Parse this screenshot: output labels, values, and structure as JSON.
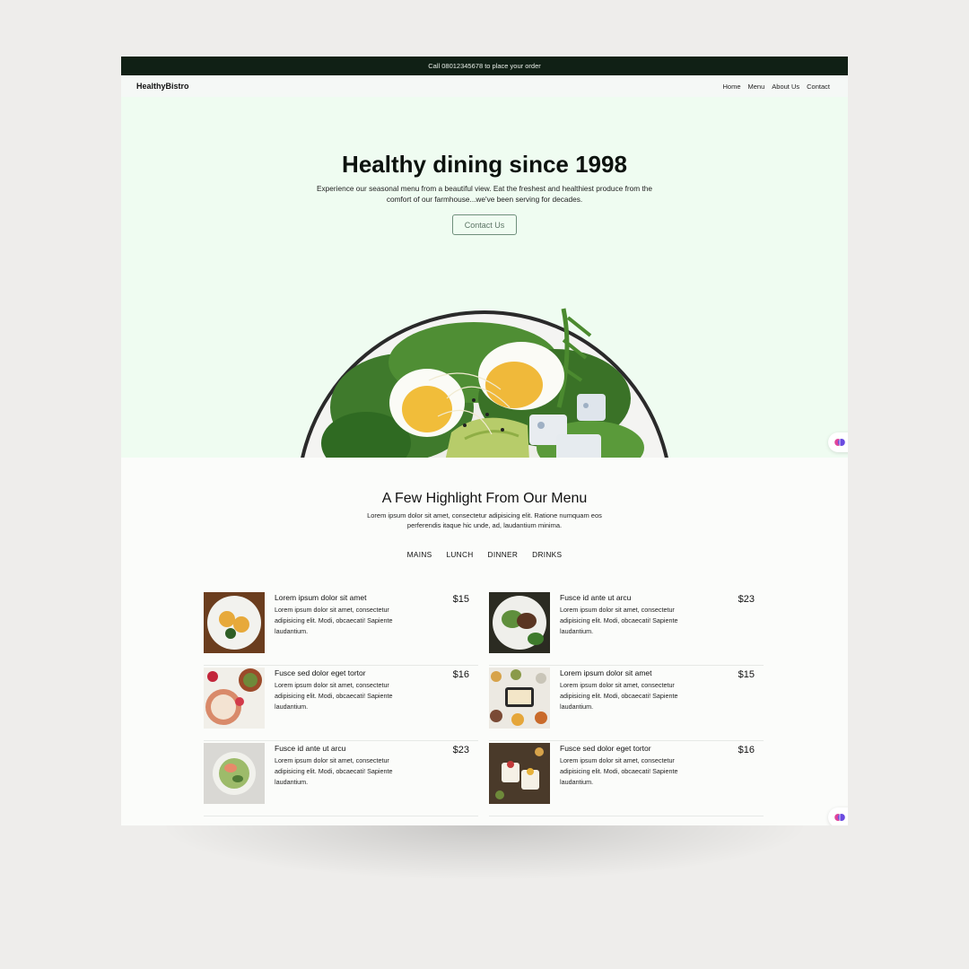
{
  "topbar": {
    "text": "Call 08012345678 to place your order"
  },
  "nav": {
    "brand": "HealthyBistro",
    "links": [
      "Home",
      "Menu",
      "About Us",
      "Contact"
    ]
  },
  "hero": {
    "title": "Healthy dining since 1998",
    "subtitle": "Experience our seasonal menu from a beautiful view. Eat the freshest and healthiest produce from the comfort of our farmhouse...we've been serving for decades.",
    "cta": "Contact Us"
  },
  "menu": {
    "heading": "A Few Highlight From Our Menu",
    "intro": "Lorem ipsum dolor sit amet, consectetur adipisicing elit. Ratione numquam eos perferendis itaque hic unde, ad, laudantium minima.",
    "tabs": [
      "MAINS",
      "LUNCH",
      "DINNER",
      "DRINKS"
    ],
    "items": [
      {
        "name": "Lorem ipsum dolor sit amet",
        "desc": "Lorem ipsum dolor sit amet, consectetur adipisicing elit. Modi, obcaecati! Sapiente laudantium.",
        "price": "$15"
      },
      {
        "name": "Fusce id ante ut arcu",
        "desc": "Lorem ipsum dolor sit amet, consectetur adipisicing elit. Modi, obcaecati! Sapiente laudantium.",
        "price": "$23"
      },
      {
        "name": "Fusce sed dolor eget tortor",
        "desc": "Lorem ipsum dolor sit amet, consectetur adipisicing elit. Modi, obcaecati! Sapiente laudantium.",
        "price": "$16"
      },
      {
        "name": "Lorem ipsum dolor sit amet",
        "desc": "Lorem ipsum dolor sit amet, consectetur adipisicing elit. Modi, obcaecati! Sapiente laudantium.",
        "price": "$15"
      },
      {
        "name": "Fusce id ante ut arcu",
        "desc": "Lorem ipsum dolor sit amet, consectetur adipisicing elit. Modi, obcaecati! Sapiente laudantium.",
        "price": "$23"
      },
      {
        "name": "Fusce sed dolor eget tortor",
        "desc": "Lorem ipsum dolor sit amet, consectetur adipisicing elit. Modi, obcaecati! Sapiente laudantium.",
        "price": "$16"
      }
    ]
  },
  "floating_buttons": [
    {
      "icon": "brain-icon"
    },
    {
      "icon": "brain-icon"
    }
  ],
  "colors": {
    "topbar": "#102015",
    "hero_bg": "#effcf1",
    "cta_border": "#6f8f7c",
    "page_bg": "#fbfcfa",
    "frame_bg": "#eeedeb"
  }
}
